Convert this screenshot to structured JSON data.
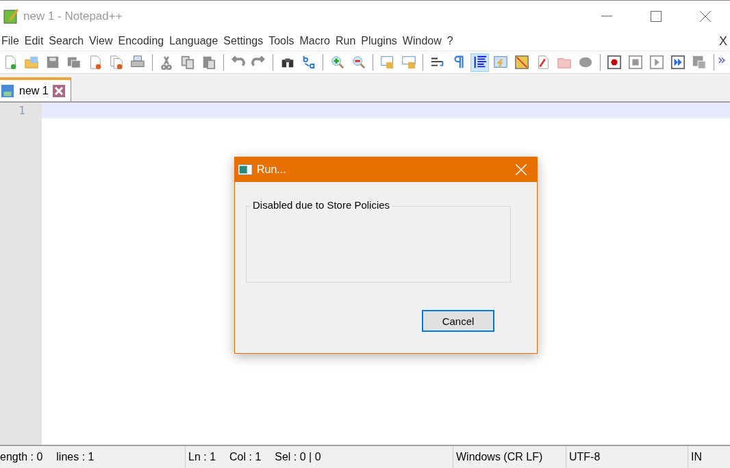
{
  "window": {
    "title": "new 1 - Notepad++",
    "active": false
  },
  "menu": {
    "items": [
      "File",
      "Edit",
      "Search",
      "View",
      "Encoding",
      "Language",
      "Settings",
      "Tools",
      "Macro",
      "Run",
      "Plugins",
      "Window",
      "?"
    ],
    "close_label": "X"
  },
  "toolbar": {
    "groups": [
      [
        {
          "selected": false
        },
        {
          "selected": false
        },
        {
          "selected": false
        },
        {
          "selected": false
        },
        {
          "selected": false
        },
        {
          "selected": false
        },
        {
          "selected": false
        }
      ],
      [
        {
          "selected": false
        },
        {
          "selected": false
        },
        {
          "selected": false
        }
      ],
      [
        {
          "selected": false
        },
        {
          "selected": false
        }
      ],
      [
        {
          "selected": false
        },
        {
          "selected": false
        }
      ],
      [
        {
          "selected": false
        },
        {
          "selected": false
        }
      ],
      [
        {
          "selected": false
        },
        {
          "selected": false
        }
      ],
      [
        {
          "selected": false
        },
        {
          "selected": false
        },
        {
          "selected": true
        },
        {
          "selected": false
        },
        {
          "selected": false
        },
        {
          "selected": false
        },
        {
          "selected": false
        },
        {
          "selected": false
        }
      ],
      [
        {
          "selected": false
        },
        {
          "selected": false
        },
        {
          "selected": false
        },
        {
          "selected": false
        },
        {
          "selected": false
        }
      ]
    ],
    "overflow": "»"
  },
  "tabs": [
    {
      "label": "new 1",
      "selected": true
    }
  ],
  "editor": {
    "line_numbers": [
      "1"
    ]
  },
  "dialog": {
    "title": "Run...",
    "group_label": "Disabled due to Store Policies",
    "buttons": [
      {
        "label": "Cancel",
        "selected": true
      }
    ]
  },
  "status_bar": [
    "ength : 0",
    "lines : 1",
    "Ln : 1",
    "Col : 1",
    "Sel : 0 | 0",
    "Windows (CR LF)",
    "UTF-8",
    "IN"
  ]
}
